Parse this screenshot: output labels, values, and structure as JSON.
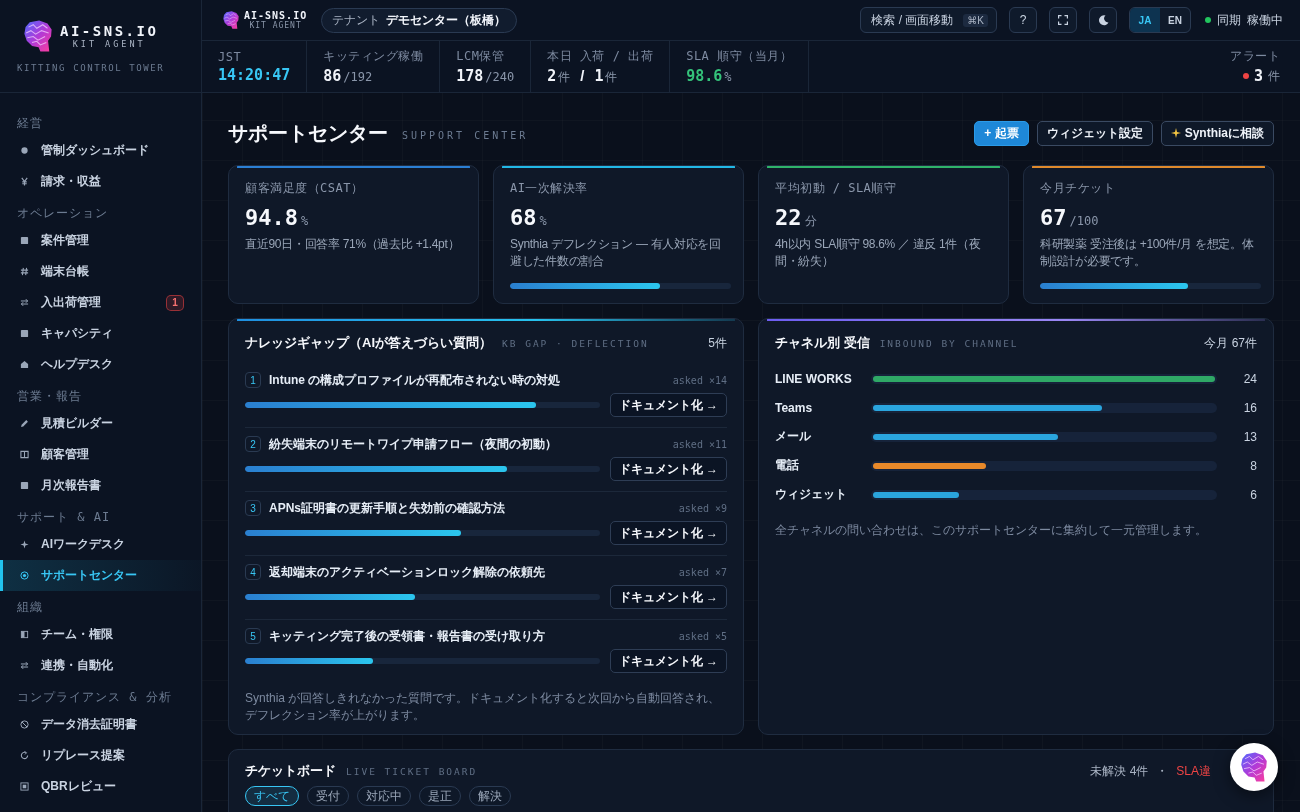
{
  "sidebar": {
    "logo": {
      "name": "AI-SNS.IO",
      "sub": "KIT AGENT"
    },
    "tagline": "KITTING CONTROL TOWER",
    "sections": [
      {
        "label": "経営",
        "items": [
          {
            "label": "管制ダッシュボード",
            "selected": false
          },
          {
            "label": "請求・収益",
            "selected": false
          }
        ]
      },
      {
        "label": "オペレーション",
        "items": [
          {
            "label": "案件管理",
            "selected": false
          },
          {
            "label": "端末台帳",
            "selected": false
          },
          {
            "label": "入出荷管理",
            "selected": false,
            "badge": "1"
          },
          {
            "label": "キャパシティ",
            "selected": false
          },
          {
            "label": "ヘルプデスク",
            "selected": false
          }
        ]
      },
      {
        "label": "営業・報告",
        "items": [
          {
            "label": "見積ビルダー",
            "selected": false
          },
          {
            "label": "顧客管理",
            "selected": false
          },
          {
            "label": "月次報告書",
            "selected": false
          }
        ]
      },
      {
        "label": "サポート & AI",
        "items": [
          {
            "label": "AIワークデスク",
            "selected": false
          },
          {
            "label": "サポートセンター",
            "selected": true
          }
        ]
      },
      {
        "label": "組織",
        "items": [
          {
            "label": "チーム・権限",
            "selected": false
          },
          {
            "label": "連携・自動化",
            "selected": false
          }
        ]
      },
      {
        "label": "コンプライアンス & 分析",
        "items": [
          {
            "label": "データ消去証明書",
            "selected": false
          },
          {
            "label": "リプレース提案",
            "selected": false
          },
          {
            "label": "QBRレビュー",
            "selected": false
          }
        ]
      }
    ]
  },
  "topbar": {
    "logo": {
      "name": "AI-SNS.IO",
      "sub": "KIT AGENT"
    },
    "tenant": {
      "label": "テナント",
      "value": "デモセンター（板橋）"
    },
    "search": {
      "label": "検索 / 画面移動",
      "shortcut": "⌘K"
    },
    "help": "?",
    "languages": [
      {
        "label": "JA",
        "selected": true
      },
      {
        "label": "EN",
        "selected": false
      }
    ],
    "sync": {
      "label": "同期",
      "value": "稼働中",
      "online": true
    }
  },
  "stats": [
    {
      "label": "JST",
      "color": "#38c6f4",
      "parts": [
        {
          "kind": "num",
          "text": "14:20:47"
        }
      ]
    },
    {
      "label": "キッティング稼働",
      "color": "#f1f4fa",
      "parts": [
        {
          "kind": "num",
          "text": "86"
        },
        {
          "kind": "unit",
          "text": "/192"
        }
      ]
    },
    {
      "label": "LCM保管",
      "color": "#f1f4fa",
      "parts": [
        {
          "kind": "num",
          "text": "178"
        },
        {
          "kind": "unit",
          "text": "/240"
        }
      ]
    },
    {
      "label": "本日 入荷 / 出荷",
      "color": "#f1f4fa",
      "parts": [
        {
          "kind": "num",
          "text": "2"
        },
        {
          "kind": "unit",
          "text": "件"
        },
        {
          "kind": "sep",
          "text": "/"
        },
        {
          "kind": "num",
          "text": "1"
        },
        {
          "kind": "unit",
          "text": "件"
        }
      ]
    },
    {
      "label": "SLA 順守（当月）",
      "color": "#34c27a",
      "parts": [
        {
          "kind": "num",
          "text": "98.6"
        },
        {
          "kind": "unit",
          "text": "%"
        }
      ]
    }
  ],
  "alert": {
    "label": "アラート",
    "value": "3",
    "unit": "件"
  },
  "page": {
    "title": "サポートセンター",
    "subtitle": "SUPPORT CENTER",
    "actions": [
      {
        "label": "+ 起票",
        "kind": "primary"
      },
      {
        "label": "ウィジェット設定",
        "kind": "outline"
      },
      {
        "label": "Synthiaに相談",
        "kind": "ai"
      }
    ]
  },
  "kpis": [
    {
      "label": "顧客満足度（CSAT）",
      "value": "94.8",
      "unit": "%",
      "note": "直近90日・回答率 71%（過去比 +1.4pt）",
      "color": "#2b7fd4"
    },
    {
      "label": "AI一次解決率",
      "value": "68",
      "unit": "%",
      "note": "Synthia デフレクション — 有人対応を回避した件数の割合",
      "level": 0.68,
      "color": "#22b8e6"
    },
    {
      "label": "平均初動 / SLA順守",
      "value": "22",
      "unit": "分",
      "note": "4h以内 SLA順守 98.6% ／ 違反 1件（夜間・紛失）",
      "color": "#2fb36a"
    },
    {
      "label": "今月チケット",
      "value": "67",
      "unit": "/100",
      "note": "科研製薬 受注後は +100件/月 を想定。体制設計が必要です。",
      "level": 0.67,
      "color": "#e08a2c"
    }
  ],
  "gaps": {
    "title": "ナレッジギャップ（AIが答えづらい質問）",
    "subtitle": "KB GAP · DEFLECTION",
    "count": "5件",
    "items": [
      {
        "number": "1",
        "question": "Intune の構成プロファイルが再配布されない時の対処",
        "asked": "asked ×14",
        "level": 0.82,
        "action": "ドキュメント化 →"
      },
      {
        "number": "2",
        "question": "紛失端末のリモートワイプ申請フロー（夜間の初動）",
        "asked": "asked ×11",
        "level": 0.74,
        "action": "ドキュメント化 →"
      },
      {
        "number": "3",
        "question": "APNs証明書の更新手順と失効前の確認方法",
        "asked": "asked ×9",
        "level": 0.61,
        "action": "ドキュメント化 →"
      },
      {
        "number": "4",
        "question": "返却端末のアクティベーションロック解除の依頼先",
        "asked": "asked ×7",
        "level": 0.48,
        "action": "ドキュメント化 →"
      },
      {
        "number": "5",
        "question": "キッティング完了後の受領書・報告書の受け取り方",
        "asked": "asked ×5",
        "level": 0.36,
        "action": "ドキュメント化 →"
      }
    ],
    "note": "Synthia が回答しきれなかった質問です。ドキュメント化すると次回から自動回答され、デフレクション率が上がります。"
  },
  "channels": {
    "title": "チャネル別 受信",
    "subtitle": "INBOUND BY CHANNEL",
    "total": "今月 67件",
    "items": [
      {
        "name": "LINE WORKS",
        "count": "24",
        "level": 1.0,
        "color": "#2fa866"
      },
      {
        "name": "Teams",
        "count": "16",
        "level": 0.67,
        "color": "#2aa5de"
      },
      {
        "name": "メール",
        "count": "13",
        "level": 0.54,
        "color": "#2aa5de"
      },
      {
        "name": "電話",
        "count": "8",
        "level": 0.33,
        "color": "#e8892a"
      },
      {
        "name": "ウィジェット",
        "count": "6",
        "level": 0.25,
        "color": "#2aa5de"
      }
    ],
    "note": "全チャネルの問い合わせは、このサポートセンターに集約して一元管理します。"
  },
  "tickets": {
    "title": "チケットボード",
    "subtitle": "LIVE TICKET BOARD",
    "summary": "未解決 4件",
    "separator": "・",
    "alert": "SLA違",
    "filters": [
      {
        "label": "すべて",
        "selected": true
      },
      {
        "label": "受付",
        "selected": false
      },
      {
        "label": "対応中",
        "selected": false
      },
      {
        "label": "是正",
        "selected": false
      },
      {
        "label": "解決",
        "selected": false
      }
    ]
  }
}
